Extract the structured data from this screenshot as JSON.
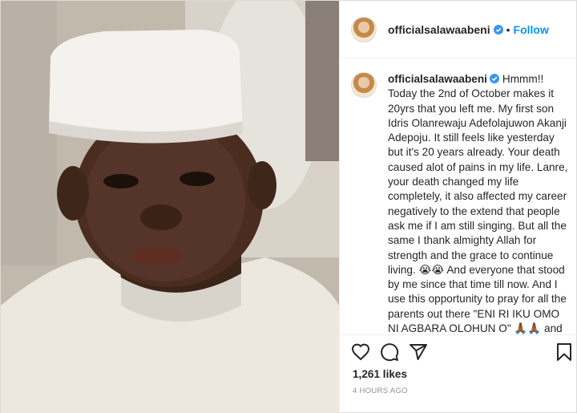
{
  "post": {
    "username": "officialsalawaabeni",
    "follow_label": "Follow",
    "separator": "•",
    "caption": "Hmmm!! Today the 2nd of October makes it 20yrs that you left me. My first son Idris Olanrewaju Adefolajuwon Akanji Adepoju. It still feels like yesterday but it's 20 years already. Your death caused alot of pains in my life. Lanre, your death changed my life completely, it also affected my career negatively to the extend that people ask me if I am still singing. But all the same I thank almighty Allah for strength and the grace to continue living. 😭😭 And everyone that stood by me since that time till now. And I use this opportunity to pray for all the parents out there \"ENI RI IKU OMO NI AGBARA OLOHUN O\" 🙏🏾🙏🏾 and to the ones that have experienced it, \"IDUNNU TON BORI IBANUJE NI OLOHUN ASE FUN GBOGBO WA\" 🙏🏾🙏🏾🙏🏾 Aameen. You would've",
    "likes": "1,261 likes",
    "timestamp": "4 HOURS AGO"
  },
  "icons": {
    "verified": "verified-badge-icon",
    "like": "heart-icon",
    "comment": "comment-bubble-icon",
    "share": "paper-plane-icon",
    "save": "bookmark-icon"
  },
  "colors": {
    "accent": "#0095f6",
    "text": "#262626",
    "muted": "#8e8e8e",
    "border": "#dbdbdb"
  }
}
